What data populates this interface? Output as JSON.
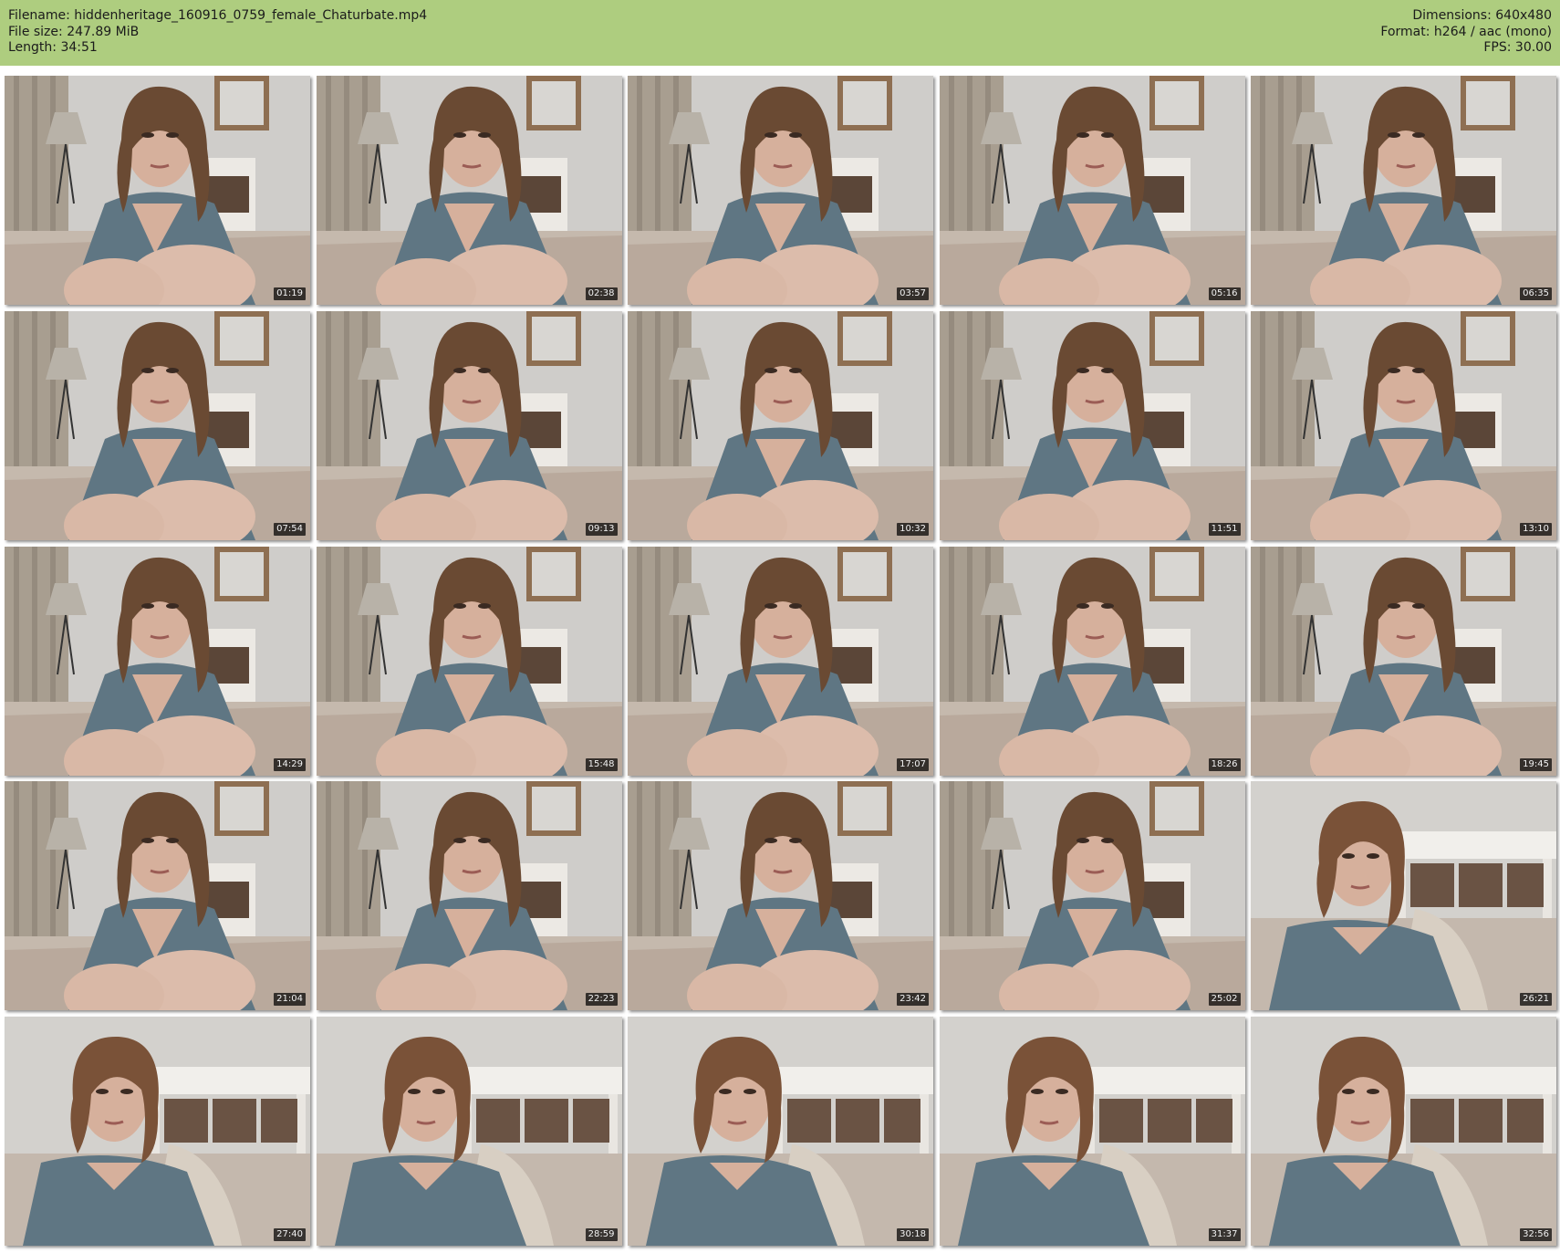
{
  "header": {
    "filename_label": "Filename: hiddenheritage_160916_0759_female_Chaturbate.mp4",
    "filesize_label": "File size: 247.89 MiB",
    "length_label": "Length: 34:51",
    "dimensions_label": "Dimensions: 640x480",
    "format_label": "Format: h264 / aac (mono)",
    "fps_label": "FPS: 30.00"
  },
  "colors": {
    "header_bg": "#aecd7f",
    "wall": "#c9c7c4",
    "curtain": "#a49a8c",
    "shirt": "#5f7683",
    "skin": "#d6b09c",
    "hair": "#6a4a33",
    "timestamp_bg": "#111111"
  },
  "thumbnails": [
    {
      "time": "01:19",
      "scene": "a"
    },
    {
      "time": "02:38",
      "scene": "a"
    },
    {
      "time": "03:57",
      "scene": "a"
    },
    {
      "time": "05:16",
      "scene": "a"
    },
    {
      "time": "06:35",
      "scene": "a"
    },
    {
      "time": "07:54",
      "scene": "a"
    },
    {
      "time": "09:13",
      "scene": "a"
    },
    {
      "time": "10:32",
      "scene": "a"
    },
    {
      "time": "11:51",
      "scene": "a"
    },
    {
      "time": "13:10",
      "scene": "a"
    },
    {
      "time": "14:29",
      "scene": "a"
    },
    {
      "time": "15:48",
      "scene": "a"
    },
    {
      "time": "17:07",
      "scene": "a"
    },
    {
      "time": "18:26",
      "scene": "a"
    },
    {
      "time": "19:45",
      "scene": "a"
    },
    {
      "time": "21:04",
      "scene": "a"
    },
    {
      "time": "22:23",
      "scene": "a"
    },
    {
      "time": "23:42",
      "scene": "a"
    },
    {
      "time": "25:02",
      "scene": "a"
    },
    {
      "time": "26:21",
      "scene": "b"
    },
    {
      "time": "27:40",
      "scene": "b"
    },
    {
      "time": "28:59",
      "scene": "b"
    },
    {
      "time": "30:18",
      "scene": "b"
    },
    {
      "time": "31:37",
      "scene": "b"
    },
    {
      "time": "32:56",
      "scene": "b"
    }
  ]
}
